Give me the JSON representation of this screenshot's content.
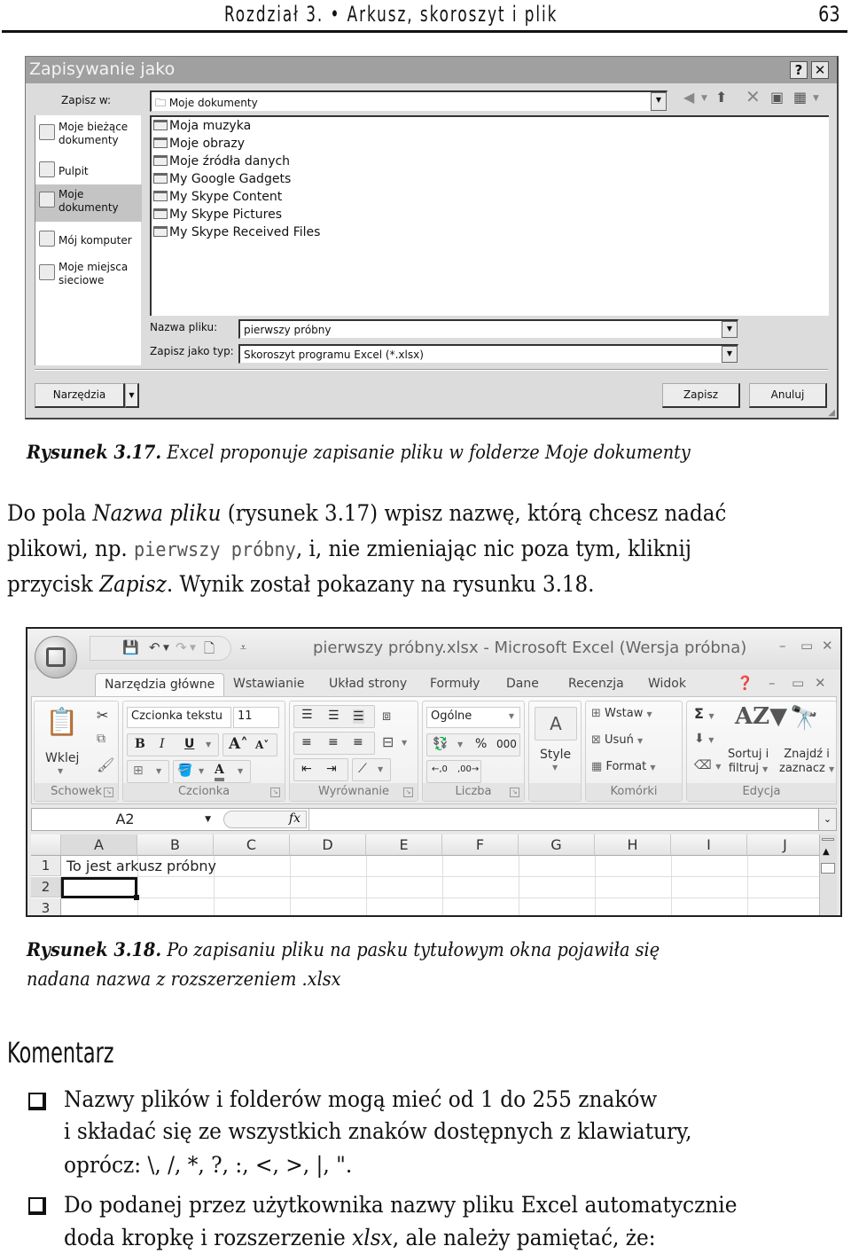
{
  "running_header": {
    "chapter": "Rozdział 3. • Arkusz, skoroszyt i plik",
    "page_number": "63"
  },
  "save_dialog": {
    "title": "Zapisywanie jako",
    "help_button": "?",
    "close_button": "✕",
    "save_in_label": "Zapisz w:",
    "save_in_value": "Moje dokumenty",
    "toolbar_icons": [
      "back-icon",
      "up-folder-icon",
      "delete-icon",
      "new-folder-icon",
      "views-icon"
    ],
    "places": [
      {
        "label_line1": "Moje bieżące",
        "label_line2": "dokumenty",
        "icon": "recent-documents-icon",
        "selected": false
      },
      {
        "label_line1": "Pulpit",
        "label_line2": "",
        "icon": "desktop-icon",
        "selected": false
      },
      {
        "label_line1": "Moje",
        "label_line2": "dokumenty",
        "icon": "my-documents-icon",
        "selected": true
      },
      {
        "label_line1": "Mój komputer",
        "label_line2": "",
        "icon": "my-computer-icon",
        "selected": false
      },
      {
        "label_line1": "Moje miejsca",
        "label_line2": "sieciowe",
        "icon": "network-places-icon",
        "selected": false
      }
    ],
    "files": [
      "Moja muzyka",
      "Moje obrazy",
      "Moje źródła danych",
      "My Google Gadgets",
      "My Skype Content",
      "My Skype Pictures",
      "My Skype Received Files"
    ],
    "filename_label": "Nazwa pliku:",
    "filename_value": "pierwszy próbny",
    "filetype_label": "Zapisz jako typ:",
    "filetype_value": "Skoroszyt programu Excel (*.xlsx)",
    "tools_button": "Narzędzia",
    "save_button": "Zapisz",
    "cancel_button": "Anuluj"
  },
  "caption_317": {
    "label": "Rysunek 3.17.",
    "text": " Excel proponuje zapisanie pliku w folderze Moje dokumenty"
  },
  "paragraph": {
    "l1_a": "Do pola ",
    "l1_b": "Nazwa pliku",
    "l1_c": " (rysunek 3.17) wpisz nazwę, którą chcesz nadać",
    "l2_a": "plikowi, np. ",
    "l2_code": "pierwszy próbny",
    "l2_c": ", i, nie zmieniając nic poza tym, kliknij",
    "l3_a": "przycisk ",
    "l3_b": "Zapisz",
    "l3_c": ". Wynik został pokazany na rysunku 3.18."
  },
  "excel": {
    "window_title": "pierwszy próbny.xlsx - Microsoft Excel (Wersja próbna)",
    "tabs": [
      "Narzędzia główne",
      "Wstawianie",
      "Układ strony",
      "Formuły",
      "Dane",
      "Recenzja",
      "Widok"
    ],
    "active_tab": "Narzędzia główne",
    "groups": {
      "clipboard": {
        "label": "Schowek",
        "paste": "Wklej"
      },
      "font": {
        "label": "Czcionka",
        "font_name": "Czcionka tekstu",
        "font_size": "11",
        "bold": "B",
        "italic": "I",
        "underline": "U"
      },
      "alignment": {
        "label": "Wyrównanie"
      },
      "number": {
        "label": "Liczba",
        "format": "Ogólne",
        "percent": "%",
        "thousands": "000"
      },
      "styles": {
        "label": "Style"
      },
      "cells": {
        "label": "Komórki",
        "insert": "Wstaw",
        "delete": "Usuń",
        "format": "Format"
      },
      "editing": {
        "label": "Edycja",
        "sum": "Σ",
        "sort_l1": "Sortuj i",
        "sort_l2": "filtruj",
        "find_l1": "Znajdź i",
        "find_l2": "zaznacz"
      }
    },
    "name_box": "A2",
    "fx": "fx",
    "columns": [
      "A",
      "B",
      "C",
      "D",
      "E",
      "F",
      "G",
      "H",
      "I",
      "J"
    ],
    "rows": [
      "1",
      "2",
      "3"
    ],
    "cell_A1": "To jest arkusz próbny",
    "selected_cell": "A2"
  },
  "caption_318": {
    "label": "Rysunek 3.18.",
    "text_l1": " Po zapisaniu pliku na pasku tytułowym okna pojawiła się",
    "text_l2": "nadana nazwa z rozszerzeniem .xlsx"
  },
  "comment": {
    "heading": "Komentarz",
    "bullet1": [
      "Nazwy plików i folderów mogą mieć od 1 do 255 znaków",
      "i składać się ze wszystkich znaków dostępnych z klawiatury,",
      "oprócz: \\, /, *, ?, :, <, >, |, \"."
    ],
    "bullet2_l1": "Do podanej przez użytkownika nazwy pliku Excel automatycznie",
    "bullet2_l2_a": "doda kropkę i rozszerzenie ",
    "bullet2_l2_b": "xlsx",
    "bullet2_l2_c": ", ale należy pamiętać, że:"
  }
}
